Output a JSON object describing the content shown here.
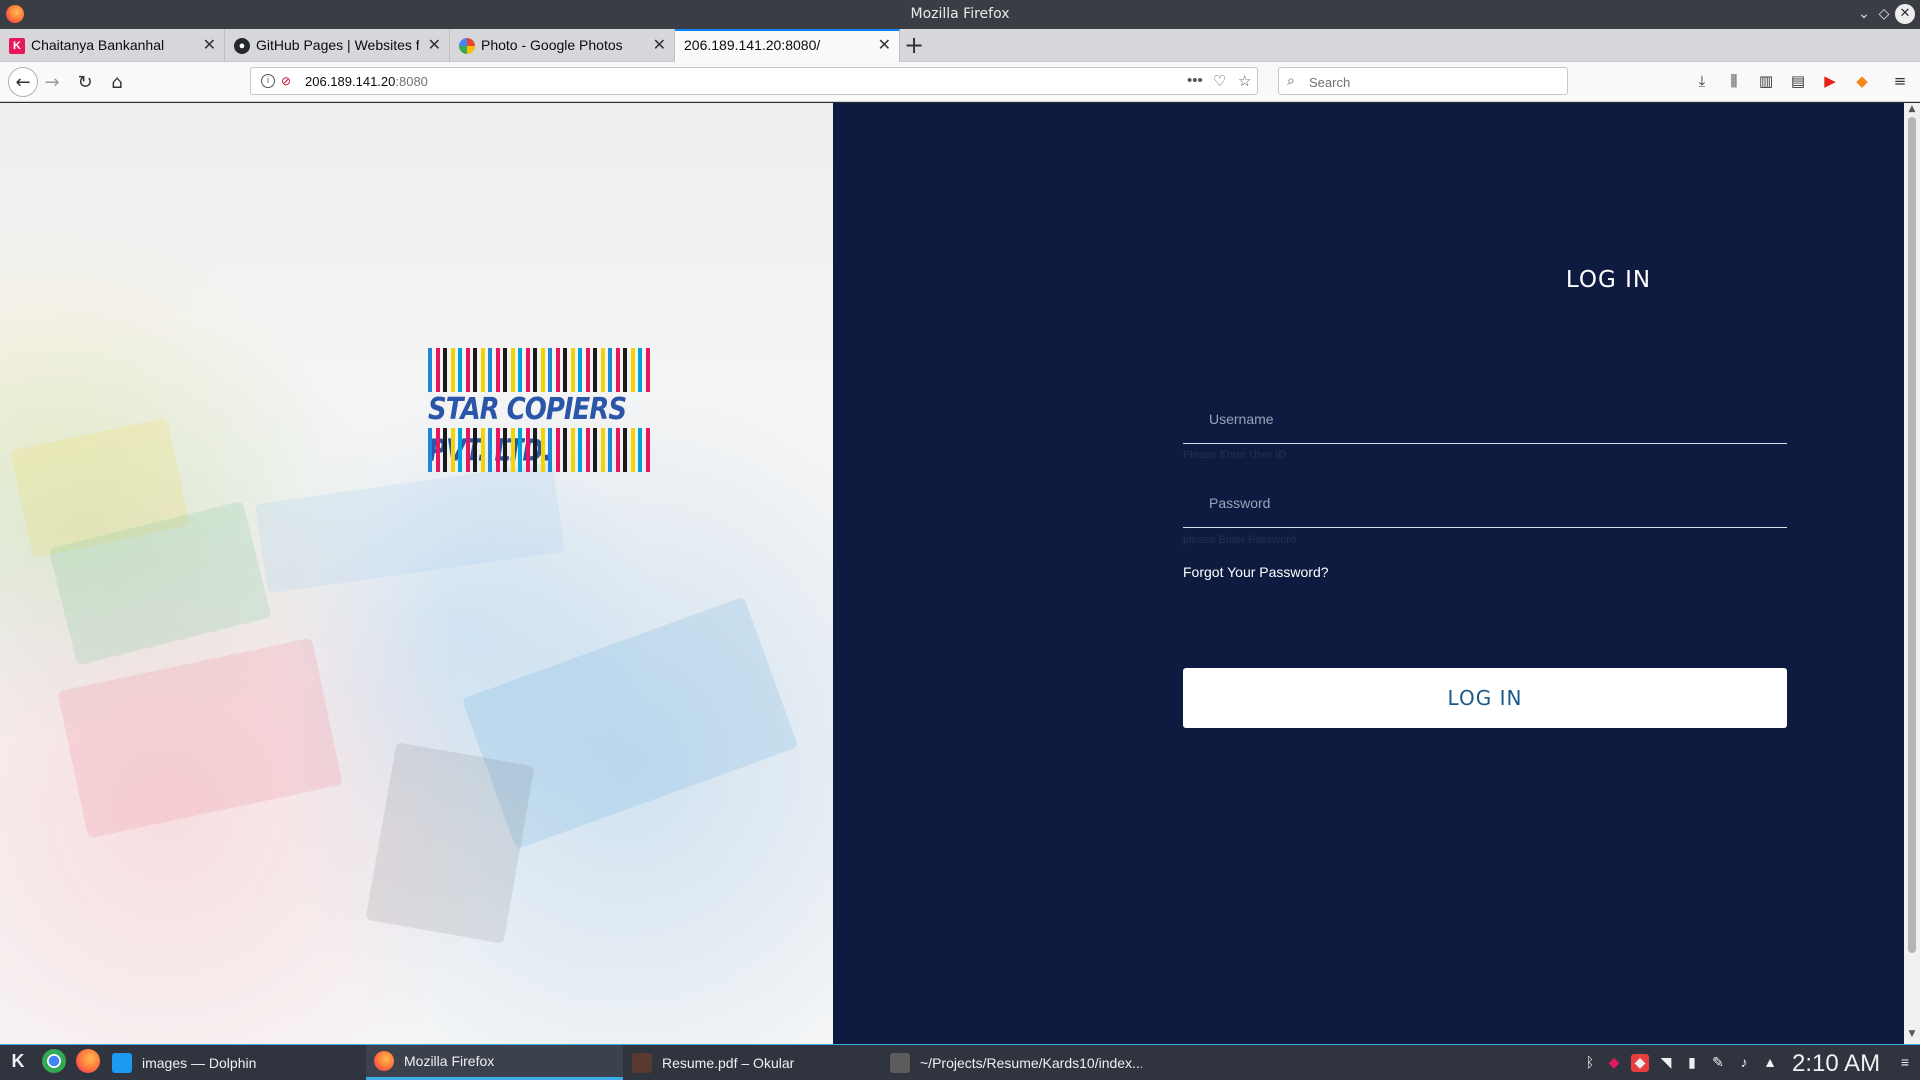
{
  "window": {
    "title": "Mozilla Firefox"
  },
  "tabs": [
    {
      "label": "Chaitanya Bankanhal",
      "favicon": "k-icon",
      "favicon_color": "#e8165b"
    },
    {
      "label": "GitHub Pages | Websites fo",
      "favicon": "github-icon",
      "favicon_color": "#24292e"
    },
    {
      "label": "Photo - Google Photos",
      "favicon": "google-photos-icon",
      "favicon_color": "#fbbc05"
    },
    {
      "label": "206.189.141.20:8080/",
      "favicon": "",
      "active": true
    }
  ],
  "navbar": {
    "url_host": "206.189.141.20",
    "url_port": ":8080",
    "search_placeholder": "Search"
  },
  "page": {
    "logo_text": "STAR COPIERS PVT. LTD.",
    "logo_stripe_colors": [
      "#1e88d8",
      "#e8175d",
      "#1a1a1a",
      "#f5d300",
      "#00a3d9",
      "#e8175d",
      "#1a1a1a",
      "#f5d300"
    ],
    "login_title": "LOG IN",
    "username_placeholder": "Username",
    "username_hint": "Please Enter User ID",
    "password_placeholder": "Password",
    "password_hint": "please Enter Password",
    "forgot_password": "Forgot Your Password?",
    "login_button": "LOG IN",
    "panel_color": "#0e1a3f"
  },
  "taskbar": {
    "tasks": [
      {
        "label": "images — Dolphin",
        "icon": "folder-icon",
        "color": "#1d99f3"
      },
      {
        "label": "Mozilla Firefox",
        "icon": "firefox-icon",
        "color": "#ff7139",
        "active": true
      },
      {
        "label": "Resume.pdf – Okular",
        "icon": "okular-icon",
        "color": "#5b3a2e"
      },
      {
        "label": "~/Projects/Resume/Kards10/index...",
        "icon": "sublime-icon",
        "color": "#5c5c5c"
      }
    ],
    "clock": "2:10 AM"
  }
}
